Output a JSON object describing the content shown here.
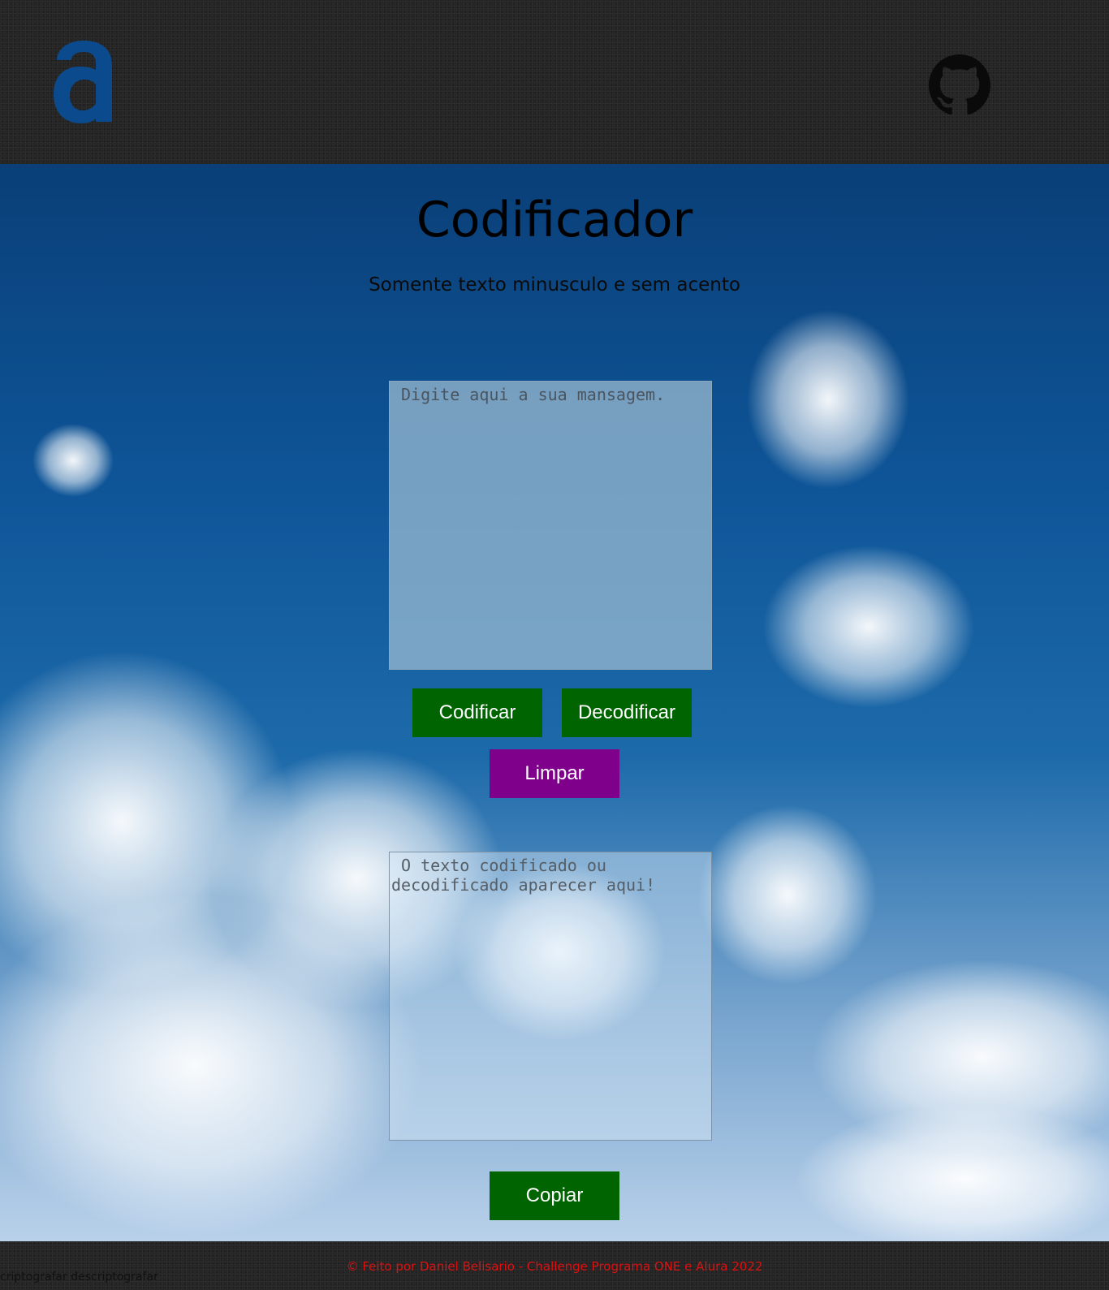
{
  "header": {
    "logo_letter": "a",
    "logo_color": "#0b4a8c",
    "github_icon": "github-icon"
  },
  "main": {
    "title": "Codificador",
    "subtitle": "Somente texto minusculo e sem acento",
    "input": {
      "value": "",
      "placeholder": "Digite aqui a sua mansagem."
    },
    "buttons": {
      "encode": "Codificar",
      "decode": "Decodificar",
      "clear": "Limpar",
      "copy": "Copiar"
    },
    "output": {
      "value": "",
      "placeholder": " O texto codificado ou decodificado aparecer aqui!"
    }
  },
  "footer": {
    "credit": "© Feito por Daniel Belisario - Challenge Programa ONE e Alura 2022",
    "hidden_text": "criptografar descriptografar"
  },
  "colors": {
    "header_bg": "#232323",
    "button_green": "#006400",
    "button_purple": "#7f008a",
    "footer_text": "#e01010"
  }
}
